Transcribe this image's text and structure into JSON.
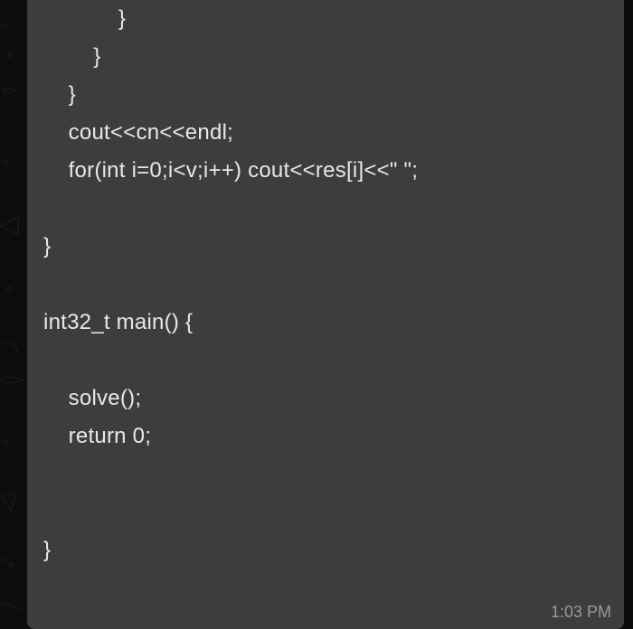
{
  "message": {
    "code_lines": [
      "            }",
      "        }",
      "    }",
      "    cout<<cn<<endl;",
      "    for(int i=0;i<v;i++) cout<<res[i]<<\" \";",
      "",
      "}",
      "",
      "int32_t main() {",
      "",
      "    solve();",
      "    return 0;",
      "",
      "",
      "}"
    ],
    "timestamp": "1:03 PM"
  }
}
